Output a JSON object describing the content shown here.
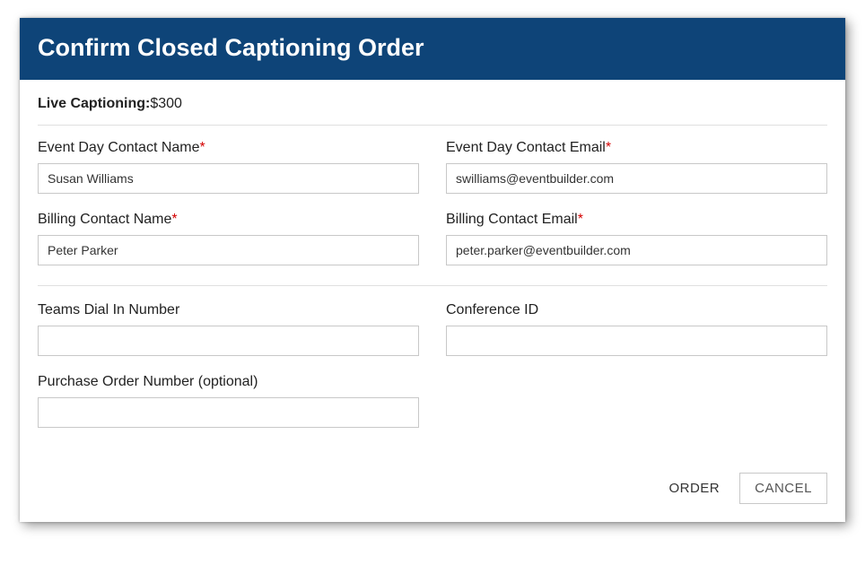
{
  "header": {
    "title": "Confirm Closed Captioning Order"
  },
  "summary": {
    "label": "Live Captioning:",
    "price": "$300"
  },
  "fields": {
    "event_contact_name": {
      "label": "Event Day Contact Name",
      "required": "*",
      "value": "Susan Williams"
    },
    "event_contact_email": {
      "label": "Event Day Contact Email",
      "required": "*",
      "value": "swilliams@eventbuilder.com"
    },
    "billing_contact_name": {
      "label": "Billing Contact Name",
      "required": "*",
      "value": "Peter Parker"
    },
    "billing_contact_email": {
      "label": "Billing Contact Email",
      "required": "*",
      "value": "peter.parker@eventbuilder.com"
    },
    "teams_dial_in": {
      "label": "Teams Dial In Number",
      "value": ""
    },
    "conference_id": {
      "label": "Conference ID",
      "value": ""
    },
    "po_number": {
      "label": "Purchase Order Number (optional)",
      "value": ""
    }
  },
  "buttons": {
    "order": "ORDER",
    "cancel": "CANCEL"
  }
}
